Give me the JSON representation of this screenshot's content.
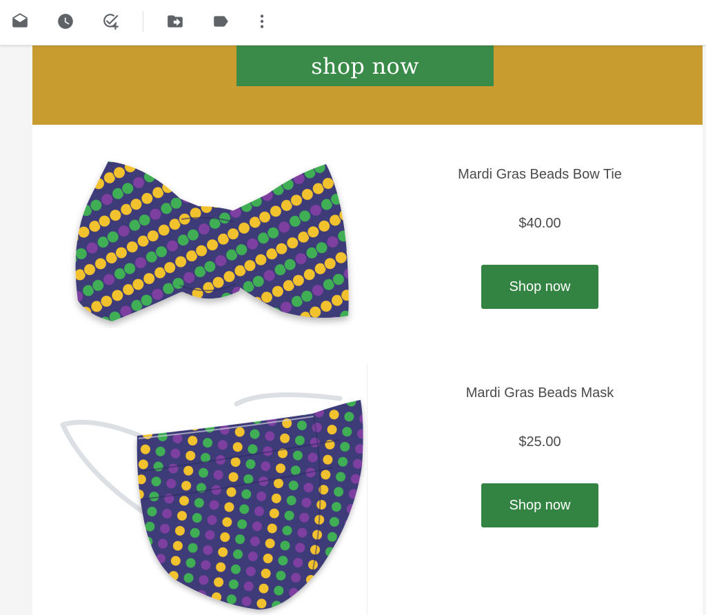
{
  "toolbar": {
    "icons": [
      "mark-read-icon",
      "snooze-icon",
      "add-task-icon",
      "move-to-icon",
      "label-icon",
      "more-vertical-icon"
    ]
  },
  "banner": {
    "button_label": "shop now",
    "background": "#c99c30",
    "button_color": "#3a8b4a"
  },
  "products": [
    {
      "name": "Mardi Gras Beads Bow Tie",
      "price": "$40.00",
      "button_label": "Shop now"
    },
    {
      "name": "Mardi Gras Beads Mask",
      "price": "$25.00",
      "button_label": "Shop now"
    }
  ],
  "colors": {
    "fabric_navy": "#3c3a78",
    "bead_gold": "#f2c12e",
    "bead_green": "#3fae55",
    "bead_purple": "#7e3fa0",
    "button_green": "#338442"
  }
}
